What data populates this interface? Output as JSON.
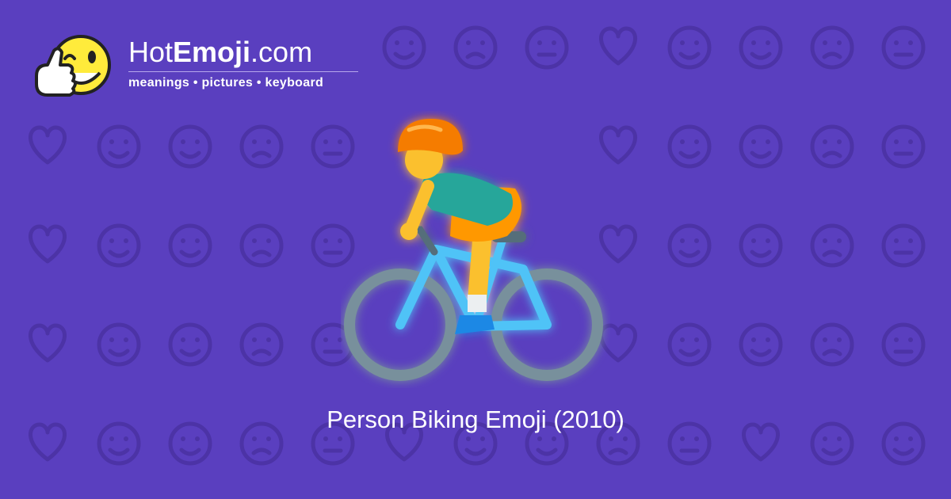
{
  "brand": {
    "name_light_1": "Hot",
    "name_bold": "Emoji",
    "name_light_2": ".com",
    "tagline": "meanings • pictures • keyboard",
    "mascot_icon": "thumbs-up-winking-face-icon"
  },
  "hero": {
    "icon": "person-biking-icon",
    "caption": "Person Biking Emoji (2010)"
  },
  "background": {
    "pattern": "emoji-outline-pattern",
    "colors": {
      "bg": "#5a3fbf",
      "pattern": "#4c33a6"
    }
  },
  "colors": {
    "helmet": "#f57c00",
    "shirt": "#26a69a",
    "shorts": "#ff9800",
    "skin": "#fbc02d",
    "bike_frame": "#4fc3f7",
    "wheel": "#78909c",
    "mascot_face": "#ffeb3b"
  }
}
